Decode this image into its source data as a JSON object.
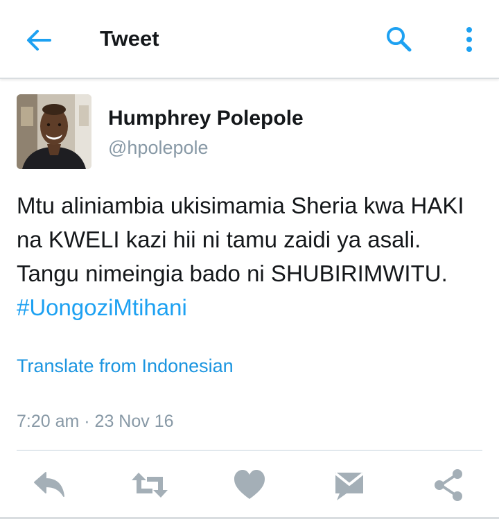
{
  "header": {
    "title": "Tweet",
    "back_icon": "back-arrow-icon",
    "search_icon": "search-icon",
    "more_icon": "more-vertical-icon",
    "accent": "#1da1f2"
  },
  "tweet": {
    "author_name": "Humphrey Polepole",
    "author_handle": "@hpolepole",
    "text": "Mtu aliniambia ukisimamia Sheria kwa HAKI na KWELI kazi hii ni tamu zaidi ya asali. Tangu nimeingia bado ni SHUBIRIMWITU.",
    "hashtag": "#UongoziMtihani",
    "translate_label": "Translate from Indonesian",
    "timestamp": "7:20 am · 23 Nov 16"
  },
  "actions": {
    "icons": [
      "reply-icon",
      "retweet-icon",
      "like-icon",
      "direct-message-icon",
      "share-icon"
    ],
    "icon_color": "#a4afb7"
  }
}
